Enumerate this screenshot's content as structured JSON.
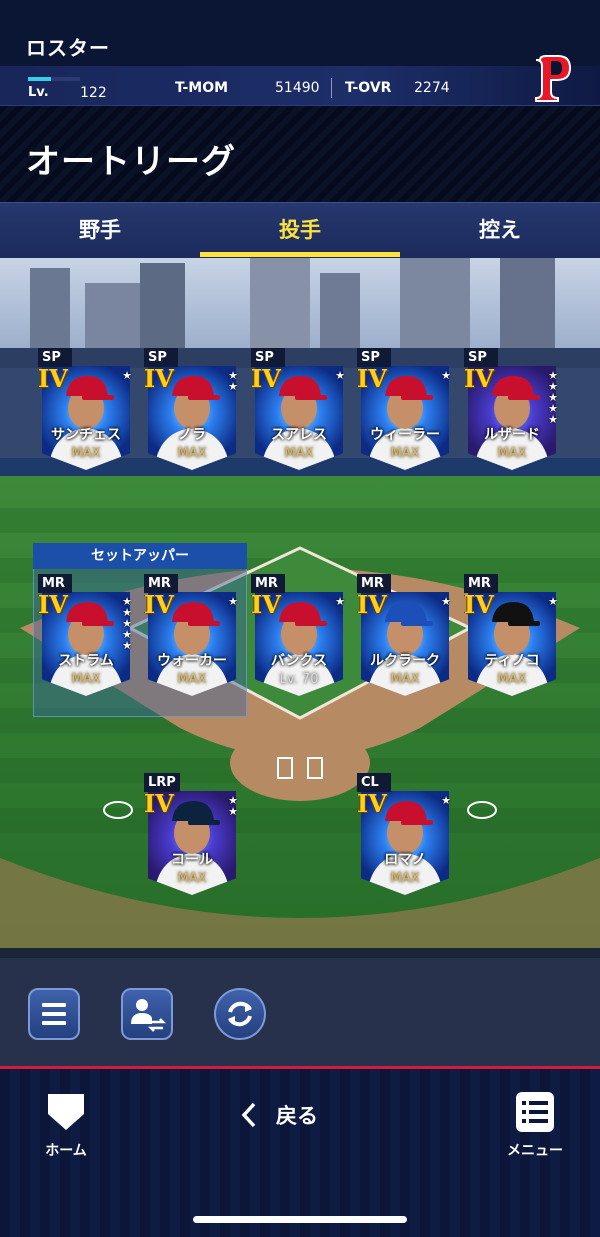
{
  "header": {
    "title": "ロスター",
    "level_label": "Lv.",
    "level_value": "122",
    "level_progress": 0.45,
    "stat1_label": "T-MOM",
    "stat1_value": "51490",
    "stat2_label": "T-OVR",
    "stat2_value": "2274",
    "team_logo": "phillies-p-logo"
  },
  "league": {
    "title": "オートリーグ"
  },
  "tabs": [
    {
      "label": "野手",
      "active": false
    },
    {
      "label": "投手",
      "active": true
    },
    {
      "label": "控え",
      "active": false
    }
  ],
  "setup_group": {
    "label": "セットアッパー"
  },
  "cards": [
    {
      "pos": "SP",
      "grade": "IV",
      "stars": 1,
      "name": "サンチェス",
      "level": "MAX",
      "theme": "blue",
      "cap": "#c8102e"
    },
    {
      "pos": "SP",
      "grade": "IV",
      "stars": 2,
      "name": "ノラ",
      "level": "MAX",
      "theme": "blue",
      "cap": "#c8102e"
    },
    {
      "pos": "SP",
      "grade": "IV",
      "stars": 1,
      "name": "スアレス",
      "level": "MAX",
      "theme": "blue",
      "cap": "#c8102e"
    },
    {
      "pos": "SP",
      "grade": "IV",
      "stars": 1,
      "name": "ウィーラー",
      "level": "MAX",
      "theme": "blue",
      "cap": "#c8102e"
    },
    {
      "pos": "SP",
      "grade": "IV",
      "stars": 5,
      "name": "ルザード",
      "level": "MAX",
      "theme": "purple",
      "cap": "#c8102e"
    },
    {
      "pos": "MR",
      "grade": "IV",
      "stars": 5,
      "name": "ストラム",
      "level": "MAX",
      "theme": "blue",
      "cap": "#c8102e"
    },
    {
      "pos": "MR",
      "grade": "IV",
      "stars": 1,
      "name": "ウォーカー",
      "level": "MAX",
      "theme": "blue",
      "cap": "#c8102e"
    },
    {
      "pos": "MR",
      "grade": "IV",
      "stars": 1,
      "name": "バンクス",
      "level": "Lv. 70",
      "theme": "blue",
      "cap": "#c8102e"
    },
    {
      "pos": "MR",
      "grade": "IV",
      "stars": 1,
      "name": "ルクラーク",
      "level": "MAX",
      "theme": "blue",
      "cap": "#1d4fb8"
    },
    {
      "pos": "MR",
      "grade": "IV",
      "stars": 1,
      "name": "ティノコ",
      "level": "MAX",
      "theme": "blue",
      "cap": "#111111"
    },
    {
      "pos": "LRP",
      "grade": "IV",
      "stars": 2,
      "name": "コール",
      "level": "MAX",
      "theme": "purple",
      "cap": "#0c2340"
    },
    {
      "pos": "CL",
      "grade": "IV",
      "stars": 1,
      "name": "ロマノ",
      "level": "MAX",
      "theme": "blue",
      "cap": "#c8102e"
    }
  ],
  "toolbar": {
    "list_icon": "list-icon",
    "swap_icon": "player-swap-icon",
    "refresh_icon": "refresh-icon"
  },
  "bottom_nav": {
    "home_label": "ホーム",
    "back_label": "戻る",
    "menu_label": "メニュー"
  }
}
